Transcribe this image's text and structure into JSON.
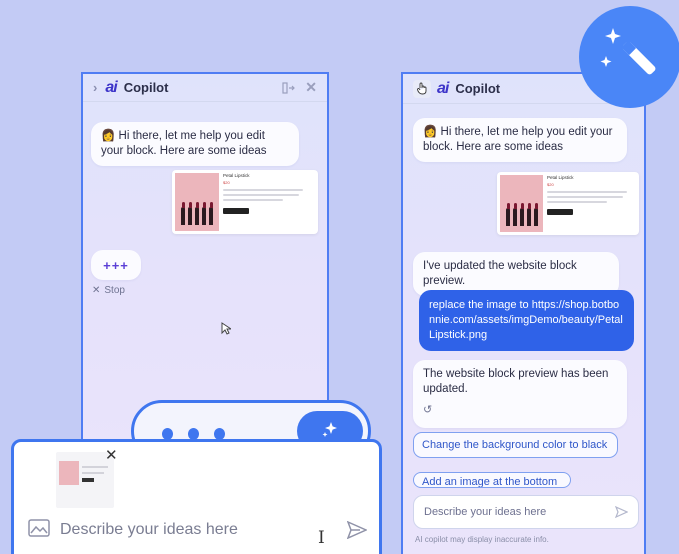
{
  "left_panel": {
    "title": "Copilot",
    "greeting": "👩 Hi there, let me help you edit your block. Here are some ideas",
    "preview": {
      "title": "Petal Lipstick",
      "price": "$20"
    },
    "loading": "+++",
    "stop_label": "Stop"
  },
  "right_panel": {
    "title": "Copilot",
    "greeting": "👩 Hi there, let me help you edit your block. Here are some ideas",
    "preview": {
      "title": "Petal Lipstick",
      "price": "$20"
    },
    "assistant_update": "I've updated the website block preview.",
    "user_message": "replace the image to https://shop.botbonnie.com/assets/imgDemo/beauty/PetalLipstick.png",
    "assistant_updated": "The website block preview has been updated.",
    "suggestions": [
      "Change the background color to black",
      "Add an image at the bottom"
    ],
    "input_placeholder": "Describe your ideas here",
    "disclaimer": "AI copilot may display inaccurate info."
  },
  "zoom_input": {
    "placeholder": "Describe your ideas here"
  },
  "colors": {
    "accent": "#3f76ef",
    "background": "#c3cbf5",
    "user_bubble": "#2f62e8"
  },
  "icons": [
    "chevron-right-icon",
    "collapse-panel-icon",
    "close-icon",
    "hand-cursor-icon",
    "magic-wand-icon",
    "sparkle-icon",
    "image-icon",
    "send-icon",
    "refresh-icon",
    "text-cursor-icon",
    "arrow-cursor-icon"
  ]
}
